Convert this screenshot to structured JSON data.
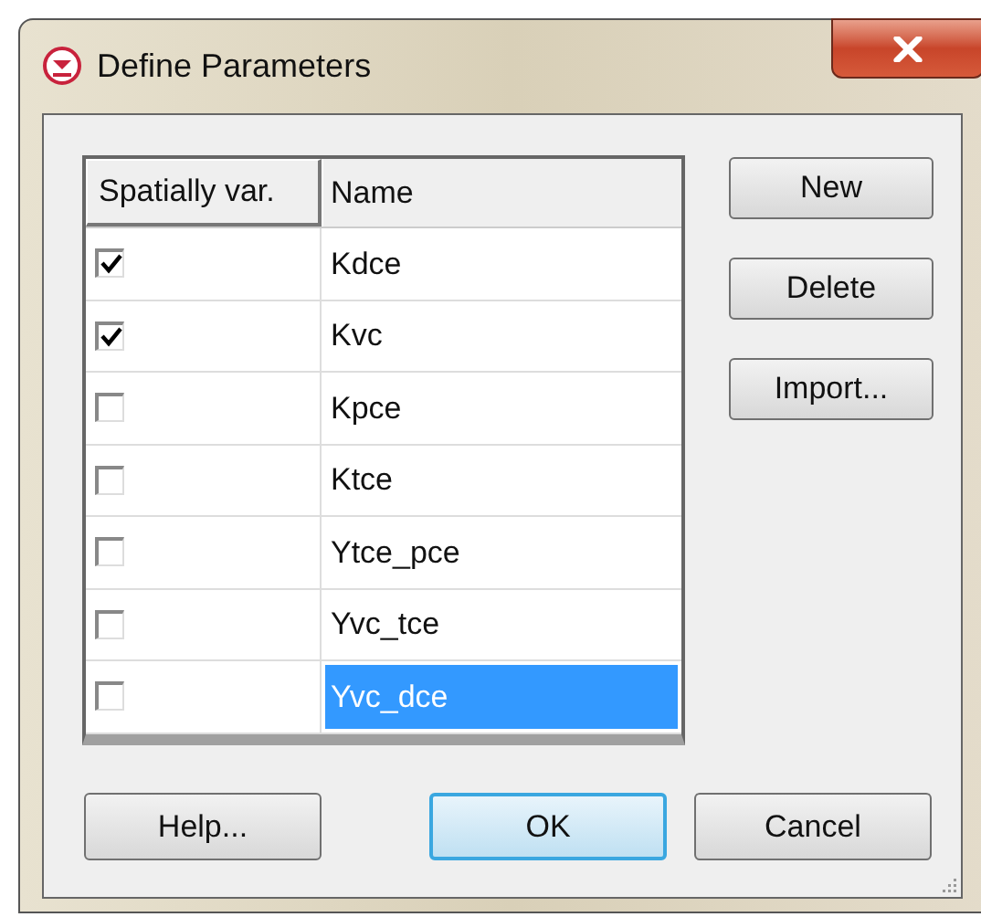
{
  "window": {
    "title": "Define Parameters"
  },
  "table": {
    "columns": [
      "Spatially var.",
      "Name"
    ],
    "rows": [
      {
        "spatially_var": true,
        "name": "Kdce",
        "selected": false
      },
      {
        "spatially_var": true,
        "name": "Kvc",
        "selected": false
      },
      {
        "spatially_var": false,
        "name": "Kpce",
        "selected": false
      },
      {
        "spatially_var": false,
        "name": "Ktce",
        "selected": false
      },
      {
        "spatially_var": false,
        "name": "Ytce_pce",
        "selected": false
      },
      {
        "spatially_var": false,
        "name": "Yvc_tce",
        "selected": false
      },
      {
        "spatially_var": false,
        "name": "Yvc_dce",
        "selected": true
      }
    ]
  },
  "side_buttons": [
    {
      "label": "New",
      "kind": "normal"
    },
    {
      "label": "Delete",
      "kind": "normal"
    },
    {
      "label": "Import...",
      "kind": "normal"
    }
  ],
  "bottom_buttons": [
    {
      "label": "Help...",
      "kind": "normal"
    },
    {
      "label": "OK",
      "kind": "default"
    },
    {
      "label": "Cancel",
      "kind": "normal"
    }
  ]
}
